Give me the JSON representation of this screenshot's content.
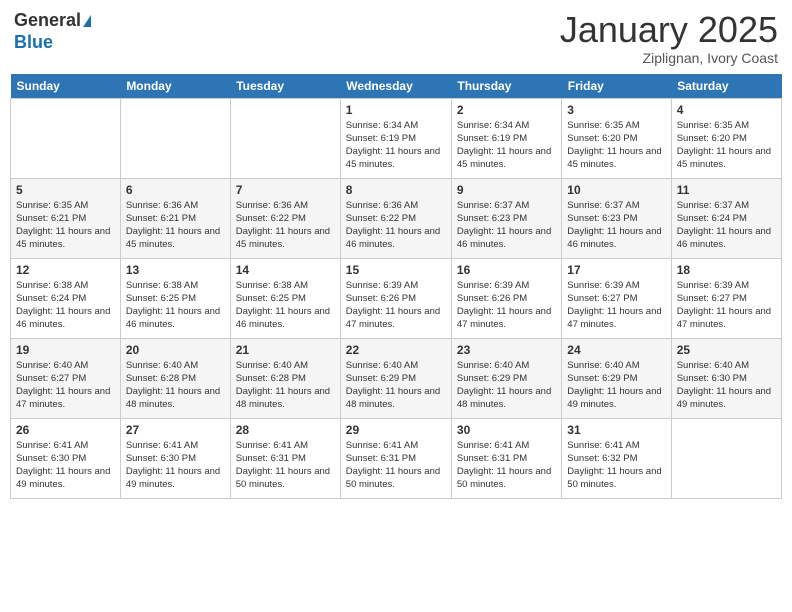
{
  "header": {
    "logo_general": "General",
    "logo_blue": "Blue",
    "month_title": "January 2025",
    "location": "Ziplignan, Ivory Coast"
  },
  "days_of_week": [
    "Sunday",
    "Monday",
    "Tuesday",
    "Wednesday",
    "Thursday",
    "Friday",
    "Saturday"
  ],
  "weeks": [
    [
      {
        "day": "",
        "sunrise": "",
        "sunset": "",
        "daylight": ""
      },
      {
        "day": "",
        "sunrise": "",
        "sunset": "",
        "daylight": ""
      },
      {
        "day": "",
        "sunrise": "",
        "sunset": "",
        "daylight": ""
      },
      {
        "day": "1",
        "sunrise": "Sunrise: 6:34 AM",
        "sunset": "Sunset: 6:19 PM",
        "daylight": "Daylight: 11 hours and 45 minutes."
      },
      {
        "day": "2",
        "sunrise": "Sunrise: 6:34 AM",
        "sunset": "Sunset: 6:19 PM",
        "daylight": "Daylight: 11 hours and 45 minutes."
      },
      {
        "day": "3",
        "sunrise": "Sunrise: 6:35 AM",
        "sunset": "Sunset: 6:20 PM",
        "daylight": "Daylight: 11 hours and 45 minutes."
      },
      {
        "day": "4",
        "sunrise": "Sunrise: 6:35 AM",
        "sunset": "Sunset: 6:20 PM",
        "daylight": "Daylight: 11 hours and 45 minutes."
      }
    ],
    [
      {
        "day": "5",
        "sunrise": "Sunrise: 6:35 AM",
        "sunset": "Sunset: 6:21 PM",
        "daylight": "Daylight: 11 hours and 45 minutes."
      },
      {
        "day": "6",
        "sunrise": "Sunrise: 6:36 AM",
        "sunset": "Sunset: 6:21 PM",
        "daylight": "Daylight: 11 hours and 45 minutes."
      },
      {
        "day": "7",
        "sunrise": "Sunrise: 6:36 AM",
        "sunset": "Sunset: 6:22 PM",
        "daylight": "Daylight: 11 hours and 45 minutes."
      },
      {
        "day": "8",
        "sunrise": "Sunrise: 6:36 AM",
        "sunset": "Sunset: 6:22 PM",
        "daylight": "Daylight: 11 hours and 46 minutes."
      },
      {
        "day": "9",
        "sunrise": "Sunrise: 6:37 AM",
        "sunset": "Sunset: 6:23 PM",
        "daylight": "Daylight: 11 hours and 46 minutes."
      },
      {
        "day": "10",
        "sunrise": "Sunrise: 6:37 AM",
        "sunset": "Sunset: 6:23 PM",
        "daylight": "Daylight: 11 hours and 46 minutes."
      },
      {
        "day": "11",
        "sunrise": "Sunrise: 6:37 AM",
        "sunset": "Sunset: 6:24 PM",
        "daylight": "Daylight: 11 hours and 46 minutes."
      }
    ],
    [
      {
        "day": "12",
        "sunrise": "Sunrise: 6:38 AM",
        "sunset": "Sunset: 6:24 PM",
        "daylight": "Daylight: 11 hours and 46 minutes."
      },
      {
        "day": "13",
        "sunrise": "Sunrise: 6:38 AM",
        "sunset": "Sunset: 6:25 PM",
        "daylight": "Daylight: 11 hours and 46 minutes."
      },
      {
        "day": "14",
        "sunrise": "Sunrise: 6:38 AM",
        "sunset": "Sunset: 6:25 PM",
        "daylight": "Daylight: 11 hours and 46 minutes."
      },
      {
        "day": "15",
        "sunrise": "Sunrise: 6:39 AM",
        "sunset": "Sunset: 6:26 PM",
        "daylight": "Daylight: 11 hours and 47 minutes."
      },
      {
        "day": "16",
        "sunrise": "Sunrise: 6:39 AM",
        "sunset": "Sunset: 6:26 PM",
        "daylight": "Daylight: 11 hours and 47 minutes."
      },
      {
        "day": "17",
        "sunrise": "Sunrise: 6:39 AM",
        "sunset": "Sunset: 6:27 PM",
        "daylight": "Daylight: 11 hours and 47 minutes."
      },
      {
        "day": "18",
        "sunrise": "Sunrise: 6:39 AM",
        "sunset": "Sunset: 6:27 PM",
        "daylight": "Daylight: 11 hours and 47 minutes."
      }
    ],
    [
      {
        "day": "19",
        "sunrise": "Sunrise: 6:40 AM",
        "sunset": "Sunset: 6:27 PM",
        "daylight": "Daylight: 11 hours and 47 minutes."
      },
      {
        "day": "20",
        "sunrise": "Sunrise: 6:40 AM",
        "sunset": "Sunset: 6:28 PM",
        "daylight": "Daylight: 11 hours and 48 minutes."
      },
      {
        "day": "21",
        "sunrise": "Sunrise: 6:40 AM",
        "sunset": "Sunset: 6:28 PM",
        "daylight": "Daylight: 11 hours and 48 minutes."
      },
      {
        "day": "22",
        "sunrise": "Sunrise: 6:40 AM",
        "sunset": "Sunset: 6:29 PM",
        "daylight": "Daylight: 11 hours and 48 minutes."
      },
      {
        "day": "23",
        "sunrise": "Sunrise: 6:40 AM",
        "sunset": "Sunset: 6:29 PM",
        "daylight": "Daylight: 11 hours and 48 minutes."
      },
      {
        "day": "24",
        "sunrise": "Sunrise: 6:40 AM",
        "sunset": "Sunset: 6:29 PM",
        "daylight": "Daylight: 11 hours and 49 minutes."
      },
      {
        "day": "25",
        "sunrise": "Sunrise: 6:40 AM",
        "sunset": "Sunset: 6:30 PM",
        "daylight": "Daylight: 11 hours and 49 minutes."
      }
    ],
    [
      {
        "day": "26",
        "sunrise": "Sunrise: 6:41 AM",
        "sunset": "Sunset: 6:30 PM",
        "daylight": "Daylight: 11 hours and 49 minutes."
      },
      {
        "day": "27",
        "sunrise": "Sunrise: 6:41 AM",
        "sunset": "Sunset: 6:30 PM",
        "daylight": "Daylight: 11 hours and 49 minutes."
      },
      {
        "day": "28",
        "sunrise": "Sunrise: 6:41 AM",
        "sunset": "Sunset: 6:31 PM",
        "daylight": "Daylight: 11 hours and 50 minutes."
      },
      {
        "day": "29",
        "sunrise": "Sunrise: 6:41 AM",
        "sunset": "Sunset: 6:31 PM",
        "daylight": "Daylight: 11 hours and 50 minutes."
      },
      {
        "day": "30",
        "sunrise": "Sunrise: 6:41 AM",
        "sunset": "Sunset: 6:31 PM",
        "daylight": "Daylight: 11 hours and 50 minutes."
      },
      {
        "day": "31",
        "sunrise": "Sunrise: 6:41 AM",
        "sunset": "Sunset: 6:32 PM",
        "daylight": "Daylight: 11 hours and 50 minutes."
      },
      {
        "day": "",
        "sunrise": "",
        "sunset": "",
        "daylight": ""
      }
    ]
  ]
}
